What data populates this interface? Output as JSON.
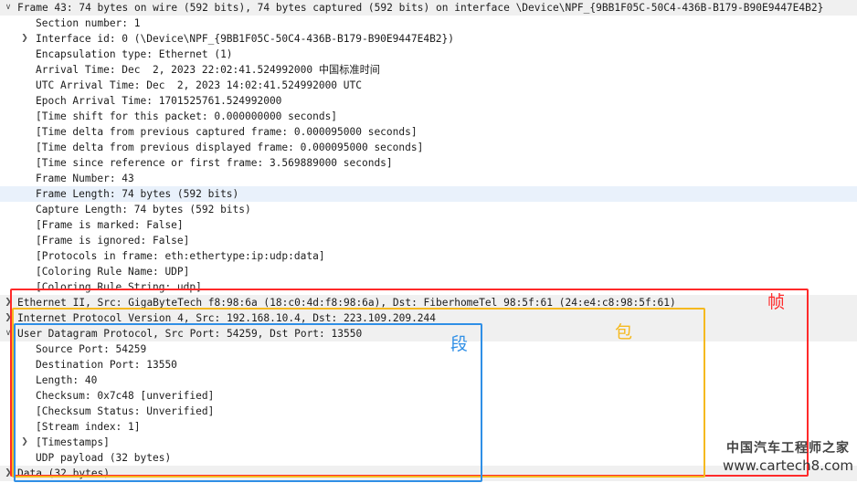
{
  "rows": [
    {
      "level": 0,
      "toggle": "expanded",
      "text": "Frame 43: 74 bytes on wire (592 bits), 74 bytes captured (592 bits) on interface \\Device\\NPF_{9BB1F05C-50C4-436B-B179-B90E9447E4B2}"
    },
    {
      "level": 1,
      "toggle": "none",
      "text": "Section number: 1"
    },
    {
      "level": 1,
      "toggle": "collapsed",
      "text": "Interface id: 0 (\\Device\\NPF_{9BB1F05C-50C4-436B-B179-B90E9447E4B2})"
    },
    {
      "level": 1,
      "toggle": "none",
      "text": "Encapsulation type: Ethernet (1)"
    },
    {
      "level": 1,
      "toggle": "none",
      "text": "Arrival Time: Dec  2, 2023 22:02:41.524992000 中国标准时间"
    },
    {
      "level": 1,
      "toggle": "none",
      "text": "UTC Arrival Time: Dec  2, 2023 14:02:41.524992000 UTC"
    },
    {
      "level": 1,
      "toggle": "none",
      "text": "Epoch Arrival Time: 1701525761.524992000"
    },
    {
      "level": 1,
      "toggle": "none",
      "text": "[Time shift for this packet: 0.000000000 seconds]"
    },
    {
      "level": 1,
      "toggle": "none",
      "text": "[Time delta from previous captured frame: 0.000095000 seconds]"
    },
    {
      "level": 1,
      "toggle": "none",
      "text": "[Time delta from previous displayed frame: 0.000095000 seconds]"
    },
    {
      "level": 1,
      "toggle": "none",
      "text": "[Time since reference or first frame: 3.569889000 seconds]"
    },
    {
      "level": 1,
      "toggle": "none",
      "text": "Frame Number: 43"
    },
    {
      "level": 1,
      "toggle": "none",
      "text": "Frame Length: 74 bytes (592 bits)",
      "selected": true
    },
    {
      "level": 1,
      "toggle": "none",
      "text": "Capture Length: 74 bytes (592 bits)"
    },
    {
      "level": 1,
      "toggle": "none",
      "text": "[Frame is marked: False]"
    },
    {
      "level": 1,
      "toggle": "none",
      "text": "[Frame is ignored: False]"
    },
    {
      "level": 1,
      "toggle": "none",
      "text": "[Protocols in frame: eth:ethertype:ip:udp:data]"
    },
    {
      "level": 1,
      "toggle": "none",
      "text": "[Coloring Rule Name: UDP]"
    },
    {
      "level": 1,
      "toggle": "none",
      "text": "[Coloring Rule String: udp]"
    },
    {
      "level": 0,
      "toggle": "collapsed",
      "text": "Ethernet II, Src: GigaByteTech_f8:98:6a (18:c0:4d:f8:98:6a), Dst: FiberhomeTel_98:5f:61 (24:e4:c8:98:5f:61)"
    },
    {
      "level": 0,
      "toggle": "collapsed",
      "text": "Internet Protocol Version 4, Src: 192.168.10.4, Dst: 223.109.209.244"
    },
    {
      "level": 0,
      "toggle": "expanded",
      "text": "User Datagram Protocol, Src Port: 54259, Dst Port: 13550"
    },
    {
      "level": 1,
      "toggle": "none",
      "text": "Source Port: 54259"
    },
    {
      "level": 1,
      "toggle": "none",
      "text": "Destination Port: 13550"
    },
    {
      "level": 1,
      "toggle": "none",
      "text": "Length: 40"
    },
    {
      "level": 1,
      "toggle": "none",
      "text": "Checksum: 0x7c48 [unverified]"
    },
    {
      "level": 1,
      "toggle": "none",
      "text": "[Checksum Status: Unverified]"
    },
    {
      "level": 1,
      "toggle": "none",
      "text": "[Stream index: 1]"
    },
    {
      "level": 1,
      "toggle": "collapsed",
      "text": "[Timestamps]"
    },
    {
      "level": 1,
      "toggle": "none",
      "text": "UDP payload (32 bytes)"
    },
    {
      "level": 0,
      "toggle": "collapsed",
      "text": "Data (32 bytes)"
    }
  ],
  "annotations": {
    "frame": {
      "label": "帧",
      "color": "#ff2a2a"
    },
    "packet": {
      "label": "包",
      "color": "#f5b91f"
    },
    "segment": {
      "label": "段",
      "color": "#2f8fe6"
    }
  },
  "watermark": {
    "chinese": "中国汽车工程师之家",
    "url": "www.cartech8.com"
  },
  "colors": {
    "selected_row": "#e9f1fb",
    "protocol_row": "#f0f0f0"
  }
}
